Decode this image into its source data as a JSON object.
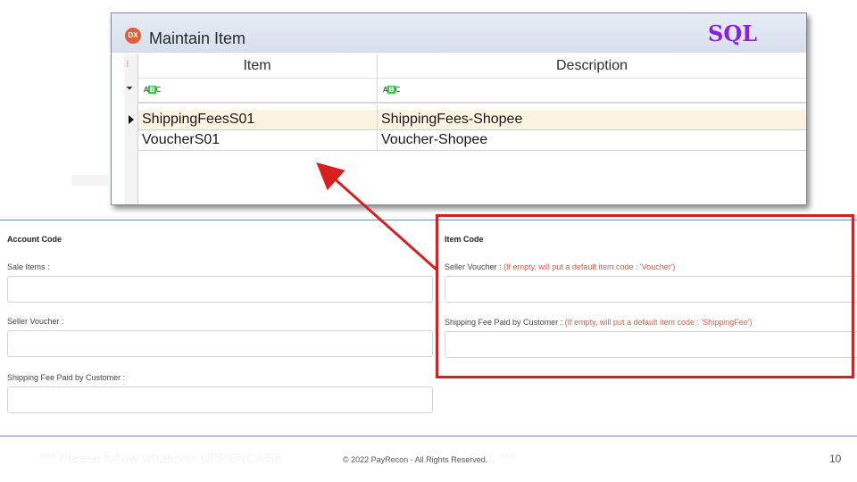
{
  "window": {
    "title": "Maintain Item",
    "sql_tag": "SQL",
    "columns": [
      "Item",
      "Description"
    ],
    "filter_icon_text": "ABC",
    "rows": [
      {
        "item": "ShippingFeesS01",
        "description": "ShippingFees-Shopee",
        "selected": true
      },
      {
        "item": "VoucherS01",
        "description": "Voucher-Shopee",
        "selected": false
      }
    ]
  },
  "account": {
    "title": "Account Code",
    "sale_items_label": "Sale Items :",
    "seller_voucher_label": "Seller Voucher :",
    "shipping_label": "Shipping Fee Paid by Customer :",
    "sale_items_value": "",
    "seller_voucher_value": "",
    "shipping_value": ""
  },
  "item_code": {
    "title": "Item Code",
    "seller_voucher_label": "Seller Voucher :",
    "seller_voucher_hint": "(If empty, will put a default item code : 'Voucher')",
    "shipping_label": "Shipping Fee Paid by Customer :",
    "shipping_hint": "(If empty, will put a default item code : 'ShippingFee')",
    "seller_voucher_value": "",
    "shipping_value": ""
  },
  "footer": {
    "ghost_left": "*** Please follow whatever UPPERCASE",
    "ghost_right": "SQL ***",
    "copyright": "© 2022 PayRecon - All Rights Reserved.",
    "page_number": "10"
  },
  "colors": {
    "highlight_box": "#d62020",
    "arrow": "#d62020",
    "sql_tag": "#8b1ee6",
    "hint_text": "#e8564a"
  }
}
